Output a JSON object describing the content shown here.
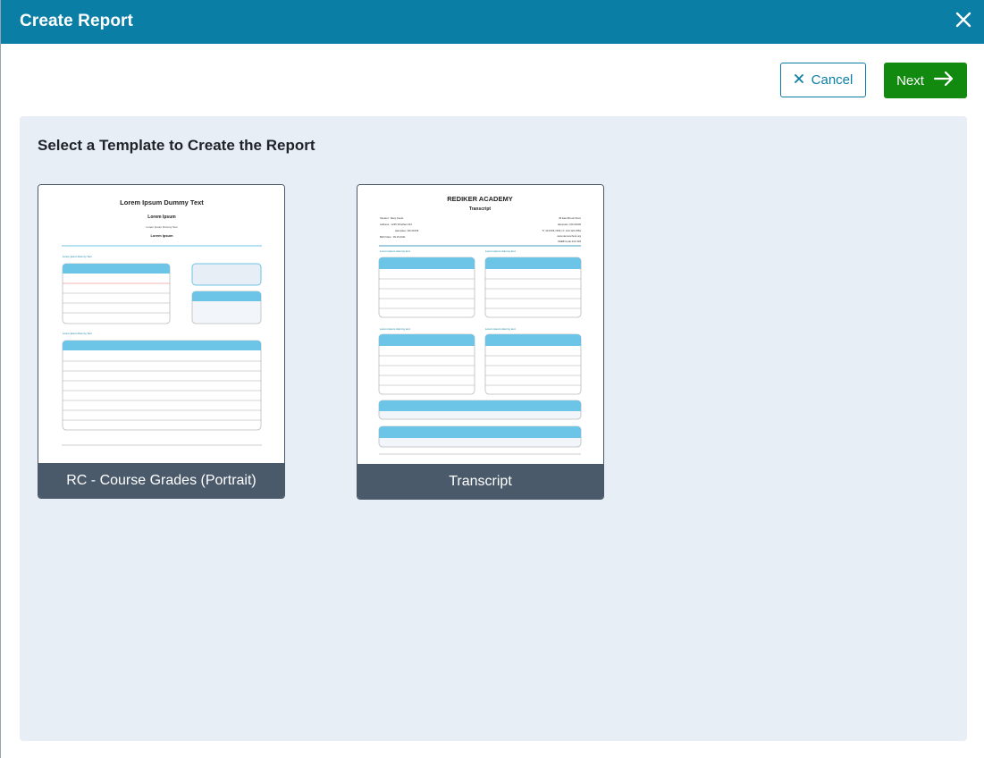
{
  "header": {
    "title": "Create Report",
    "close_icon": "close-icon"
  },
  "actions": {
    "cancel_label": "Cancel",
    "next_label": "Next"
  },
  "panel": {
    "title": "Select a Template to Create the Report"
  },
  "templates": [
    {
      "label": "RC - Course Grades (Portrait)",
      "preview": {
        "title": "Lorem Ipsum Dummy Text",
        "subtitle": "Lorem Ipsum",
        "line": "Lorem Ipsum Dummy Text",
        "subtitle2": "Lorem Ipsum",
        "section1": "Lorem Ipsum Dummy Text",
        "section2": "Lorem Ipsum Dummy Text"
      }
    },
    {
      "label": "Transcript",
      "preview": {
        "school": "REDIKER ACADEMY",
        "doc": "Transcript",
        "left": [
          "Student : Mary Keefe",
          "Address : 1245 Windham Rd",
          "Hampden, MA 01036",
          "Birth Date : 09.15.2011"
        ],
        "right": [
          "36 East Brook Drive",
          "Hampden, MA 01036",
          "Tl: 413.566.7469 | F: 413.123.1564",
          "www.demoschool.org",
          "CEEB Code:214-333"
        ],
        "section": "Lorem ipsum dummy text"
      }
    }
  ],
  "colors": {
    "header": "#0a7ea4",
    "next": "#118a0f",
    "panel": "#e8eef6",
    "card_label": "#4a5a6b",
    "thumb_accent": "#6cc4e6"
  }
}
